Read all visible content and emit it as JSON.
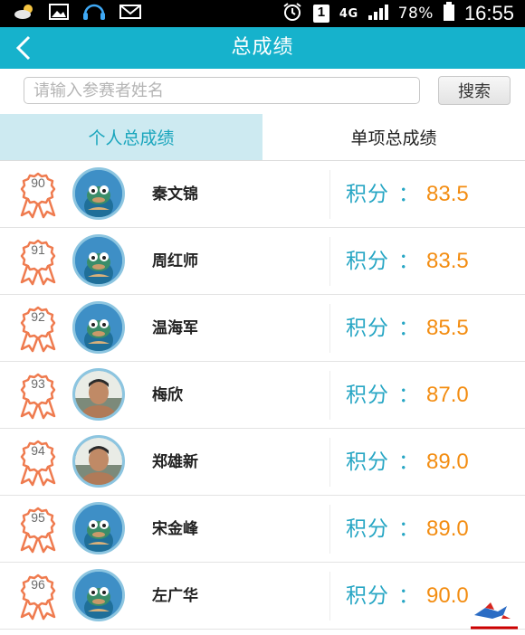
{
  "status_bar": {
    "network": "4G",
    "sim_slot": "1",
    "battery": "78%",
    "time": "16:55"
  },
  "header": {
    "title": "总成绩"
  },
  "search": {
    "placeholder": "请输入参赛者姓名",
    "value": "",
    "button_label": "搜索"
  },
  "tabs": [
    {
      "label": "个人总成绩",
      "active": true
    },
    {
      "label": "单项总成绩",
      "active": false
    }
  ],
  "score_label": "积分",
  "score_colon": "：",
  "rows": [
    {
      "rank": "90",
      "name": "秦文锦",
      "score": "83.5",
      "avatar": "mascot-avatar"
    },
    {
      "rank": "91",
      "name": "周红师",
      "score": "83.5",
      "avatar": "mascot-avatar"
    },
    {
      "rank": "92",
      "name": "温海军",
      "score": "85.5",
      "avatar": "mascot-avatar"
    },
    {
      "rank": "93",
      "name": "梅欣",
      "score": "87.0",
      "avatar": "photo-avatar"
    },
    {
      "rank": "94",
      "name": "郑雄新",
      "score": "89.0",
      "avatar": "photo-avatar"
    },
    {
      "rank": "95",
      "name": "宋金峰",
      "score": "89.0",
      "avatar": "mascot-avatar"
    },
    {
      "rank": "96",
      "name": "左广华",
      "score": "90.0",
      "avatar": "mascot-avatar"
    }
  ],
  "colors": {
    "header_bg": "#16b2cc",
    "active_tab_bg": "#cdeaf1",
    "score_label": "#27a6c4",
    "score_value": "#f38d12",
    "medal": "#ef7b4f"
  }
}
